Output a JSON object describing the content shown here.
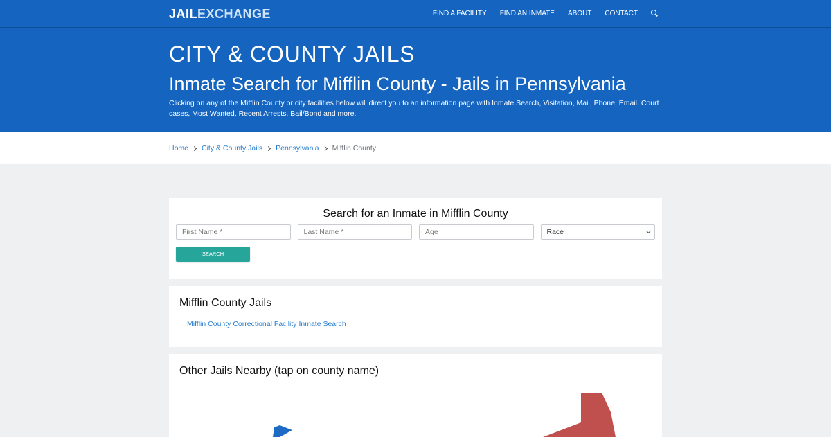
{
  "brand": {
    "part1": "JAIL",
    "part2": "EXCHANGE"
  },
  "nav": {
    "items": [
      "FIND A FACILITY",
      "FIND AN INMATE",
      "ABOUT",
      "CONTACT"
    ]
  },
  "hero": {
    "kicker": "CITY & COUNTY JAILS",
    "title": "Inmate Search for Mifflin County - Jails in Pennsylvania",
    "description": "Clicking on any of the Mifflin County or city facilities below will direct you to an information page with Inmate Search, Visitation, Mail, Phone, Email, Court cases, Most Wanted, Recent Arrests, Bail/Bond and more."
  },
  "breadcrumb": {
    "items": [
      "Home",
      "City & County Jails",
      "Pennsylvania"
    ],
    "current": "Mifflin County"
  },
  "search_card": {
    "title": "Search for an Inmate in Mifflin County",
    "first_name_placeholder": "First Name *",
    "last_name_placeholder": "Last Name *",
    "age_placeholder": "Age",
    "race_selected": "Race",
    "button_label": "SEARCH"
  },
  "jails_card": {
    "title": "Mifflin County Jails",
    "link": "Mifflin County Correctional Facility Inmate Search"
  },
  "nearby_card": {
    "title": "Other Jails Nearby (tap on county name)"
  },
  "colors": {
    "primary": "#1565c0",
    "accent": "#26a69a",
    "link": "#2a7fd0",
    "map_red": "#c62828",
    "map_blue": "#1e6bc6"
  }
}
